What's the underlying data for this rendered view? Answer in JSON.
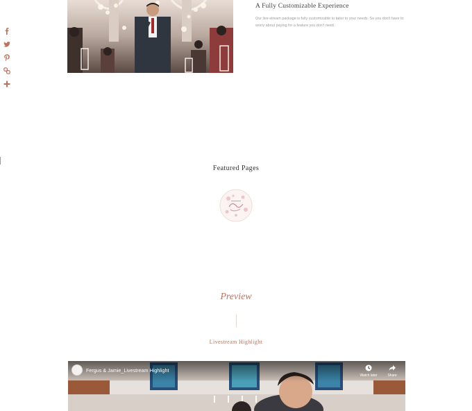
{
  "share": {
    "items": [
      {
        "name": "facebook",
        "color": "#b9735f"
      },
      {
        "name": "twitter",
        "color": "#b9735f"
      },
      {
        "name": "pinterest",
        "color": "#b9735f"
      },
      {
        "name": "copy-link",
        "color": "#b9735f"
      },
      {
        "name": "more",
        "color": "#b9735f"
      }
    ]
  },
  "feature": {
    "title": "A Fully Customizable Experience",
    "description": "Our live-stream package is fully customizable to tailor to your needs. So you don't have to worry about paying for a feature you don't need."
  },
  "featured": {
    "heading": "Featured Pages"
  },
  "preview": {
    "heading": "Preview",
    "highlight_label": "Livestream Highlight"
  },
  "video": {
    "title": "Fergus & Jamie_Livestream Highlight",
    "watch_later_label": "Watch later",
    "share_label": "Share"
  },
  "colors": {
    "accent": "#b9735f",
    "text_dark": "#333333",
    "text_muted": "#9b9b9b"
  }
}
